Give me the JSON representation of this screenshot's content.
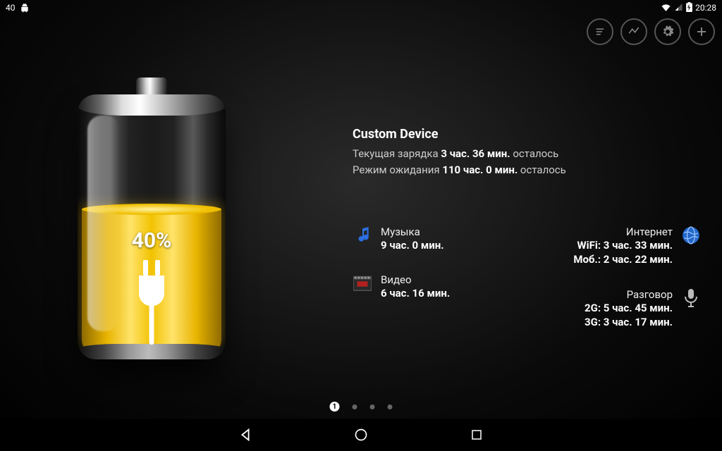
{
  "statusbar": {
    "left_text": "40",
    "time": "20:28"
  },
  "battery": {
    "percent_label": "40%"
  },
  "device": {
    "name": "Custom Device",
    "charge_prefix": "Текущая зарядка ",
    "charge_value": "3 час. 36 мин.",
    "charge_suffix": " осталось",
    "standby_prefix": "Режим ожидания ",
    "standby_value": "110 час. 0 мин.",
    "standby_suffix": " осталось"
  },
  "usage": {
    "music": {
      "title": "Музыка",
      "value": "9 час. 0 мин."
    },
    "video": {
      "title": "Видео",
      "value": "6 час. 16 мин."
    },
    "internet": {
      "title": "Интернет",
      "wifi": "WiFi: 3 час. 33 мин.",
      "mobile": "Моб.: 2 час. 22 мин."
    },
    "talk": {
      "title": "Разговор",
      "g2": "2G: 5 час. 45 мин.",
      "g3": "3G: 3 час. 17 мин."
    }
  },
  "pager": {
    "active_label": "1"
  }
}
